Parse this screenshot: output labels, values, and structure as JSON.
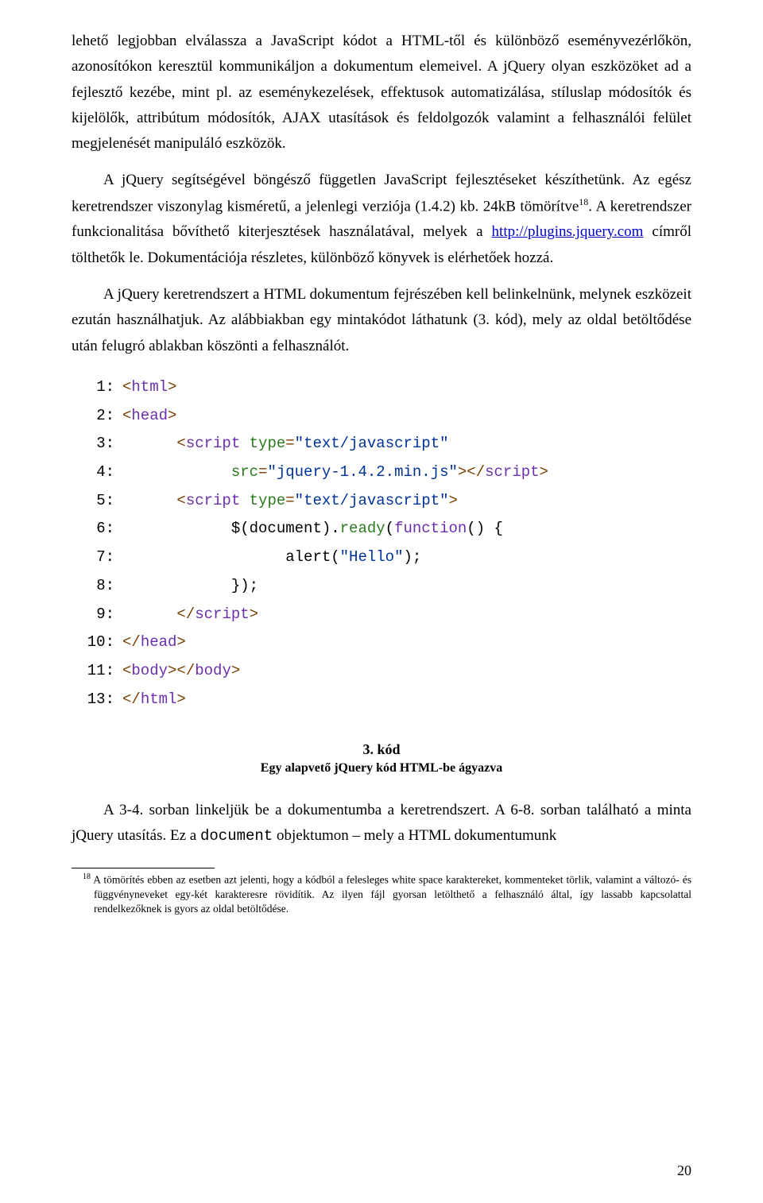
{
  "para1_a": "lehető legjobban elválassza a JavaScript kódot a HTML-től és különböző eseményvezérlőkön, azonosítókon keresztül kommunikáljon a dokumentum elemeivel. A jQuery olyan eszközöket ad a fejlesztő kezébe, mint pl. az eseménykezelések, effektusok automatizálása, stíluslap módosítók és kijelölők, attribútum módosítók, AJAX utasítások és feldolgozók valamint a felhasználói felület megjelenését manipuláló eszközök.",
  "para2_a": "A jQuery segítségével böngésző független JavaScript fejlesztéseket készíthetünk. Az egész keretrendszer viszonylag kisméretű, a jelenlegi verziója (1.4.2) kb. 24kB tömörítve",
  "para2_sup": "18",
  "para2_b": ". A keretrendszer funkcionalitása bővíthető kiterjesztések használatával, melyek a ",
  "link_text": "http://plugins.jquery.com",
  "para2_c": " címről tölthetők le. Dokumentációja részletes, különböző könyvek is elérhetőek hozzá.",
  "para3": "A jQuery keretrendszert a HTML dokumentum fejrészében kell belinkelnünk, melynek eszközeit ezután használhatjuk. Az alábbiakban egy mintakódot láthatunk (3. kód), mely az oldal betöltődése után felugró ablakban köszönti a felhasználót.",
  "code": {
    "l1": {
      "num": "1:",
      "t1": "<",
      "t2": "html",
      "t3": ">"
    },
    "l2": {
      "num": "2:",
      "t1": "<",
      "t2": "head",
      "t3": ">"
    },
    "l3": {
      "num": "3:",
      "t1": "<",
      "t2": "script ",
      "t3": "type",
      "t4": "=",
      "t5": "\"text/javascript\""
    },
    "l4": {
      "num": "4:",
      "t1": "src",
      "t2": "=",
      "t3": "\"jquery-1.4.2.min.js\"",
      "t4": "></",
      "t5": "script",
      "t6": ">"
    },
    "l5": {
      "num": "5:",
      "t1": "<",
      "t2": "script ",
      "t3": "type",
      "t4": "=",
      "t5": "\"text/javascript\"",
      "t6": ">"
    },
    "l6": {
      "num": "6:",
      "t1": "$(document).",
      "t2": "ready",
      "t3": "(",
      "t4": "function",
      "t5": "() {"
    },
    "l7": {
      "num": "7:",
      "t1": "alert(",
      "t2": "\"Hello\"",
      "t3": ");"
    },
    "l8": {
      "num": "8:",
      "t1": "});"
    },
    "l9": {
      "num": "9:",
      "t1": "</",
      "t2": "script",
      "t3": ">"
    },
    "l10": {
      "num": "10:",
      "t1": "</",
      "t2": "head",
      "t3": ">"
    },
    "l11": {
      "num": "11:",
      "t1": "<",
      "t2": "body",
      "t3": "></",
      "t4": "body",
      "t5": ">"
    },
    "l13": {
      "num": "13:",
      "t1": "</",
      "t2": "html",
      "t3": ">"
    }
  },
  "caption": {
    "title": "3. kód",
    "sub": "Egy alapvető jQuery kód HTML-be ágyazva"
  },
  "para4_a": "A 3-4. sorban linkeljük be a dokumentumba a keretrendszert. A 6-8. sorban található a minta jQuery utasítás. Ez a ",
  "para4_mono": "document",
  "para4_b": " objektumon – mely a HTML dokumentumunk",
  "footnote": {
    "num": "18",
    "text": " A tömörítés ebben az esetben azt jelenti, hogy a kódból a felesleges white space karaktereket, kommenteket törlik, valamint a változó- és függvényneveket egy-két karakteresre rövidítik. Az ilyen fájl gyorsan letölthető a felhasználó által, így lassabb kapcsolattal rendelkezőknek is gyors az oldal betöltődése."
  },
  "pagenum": "20"
}
